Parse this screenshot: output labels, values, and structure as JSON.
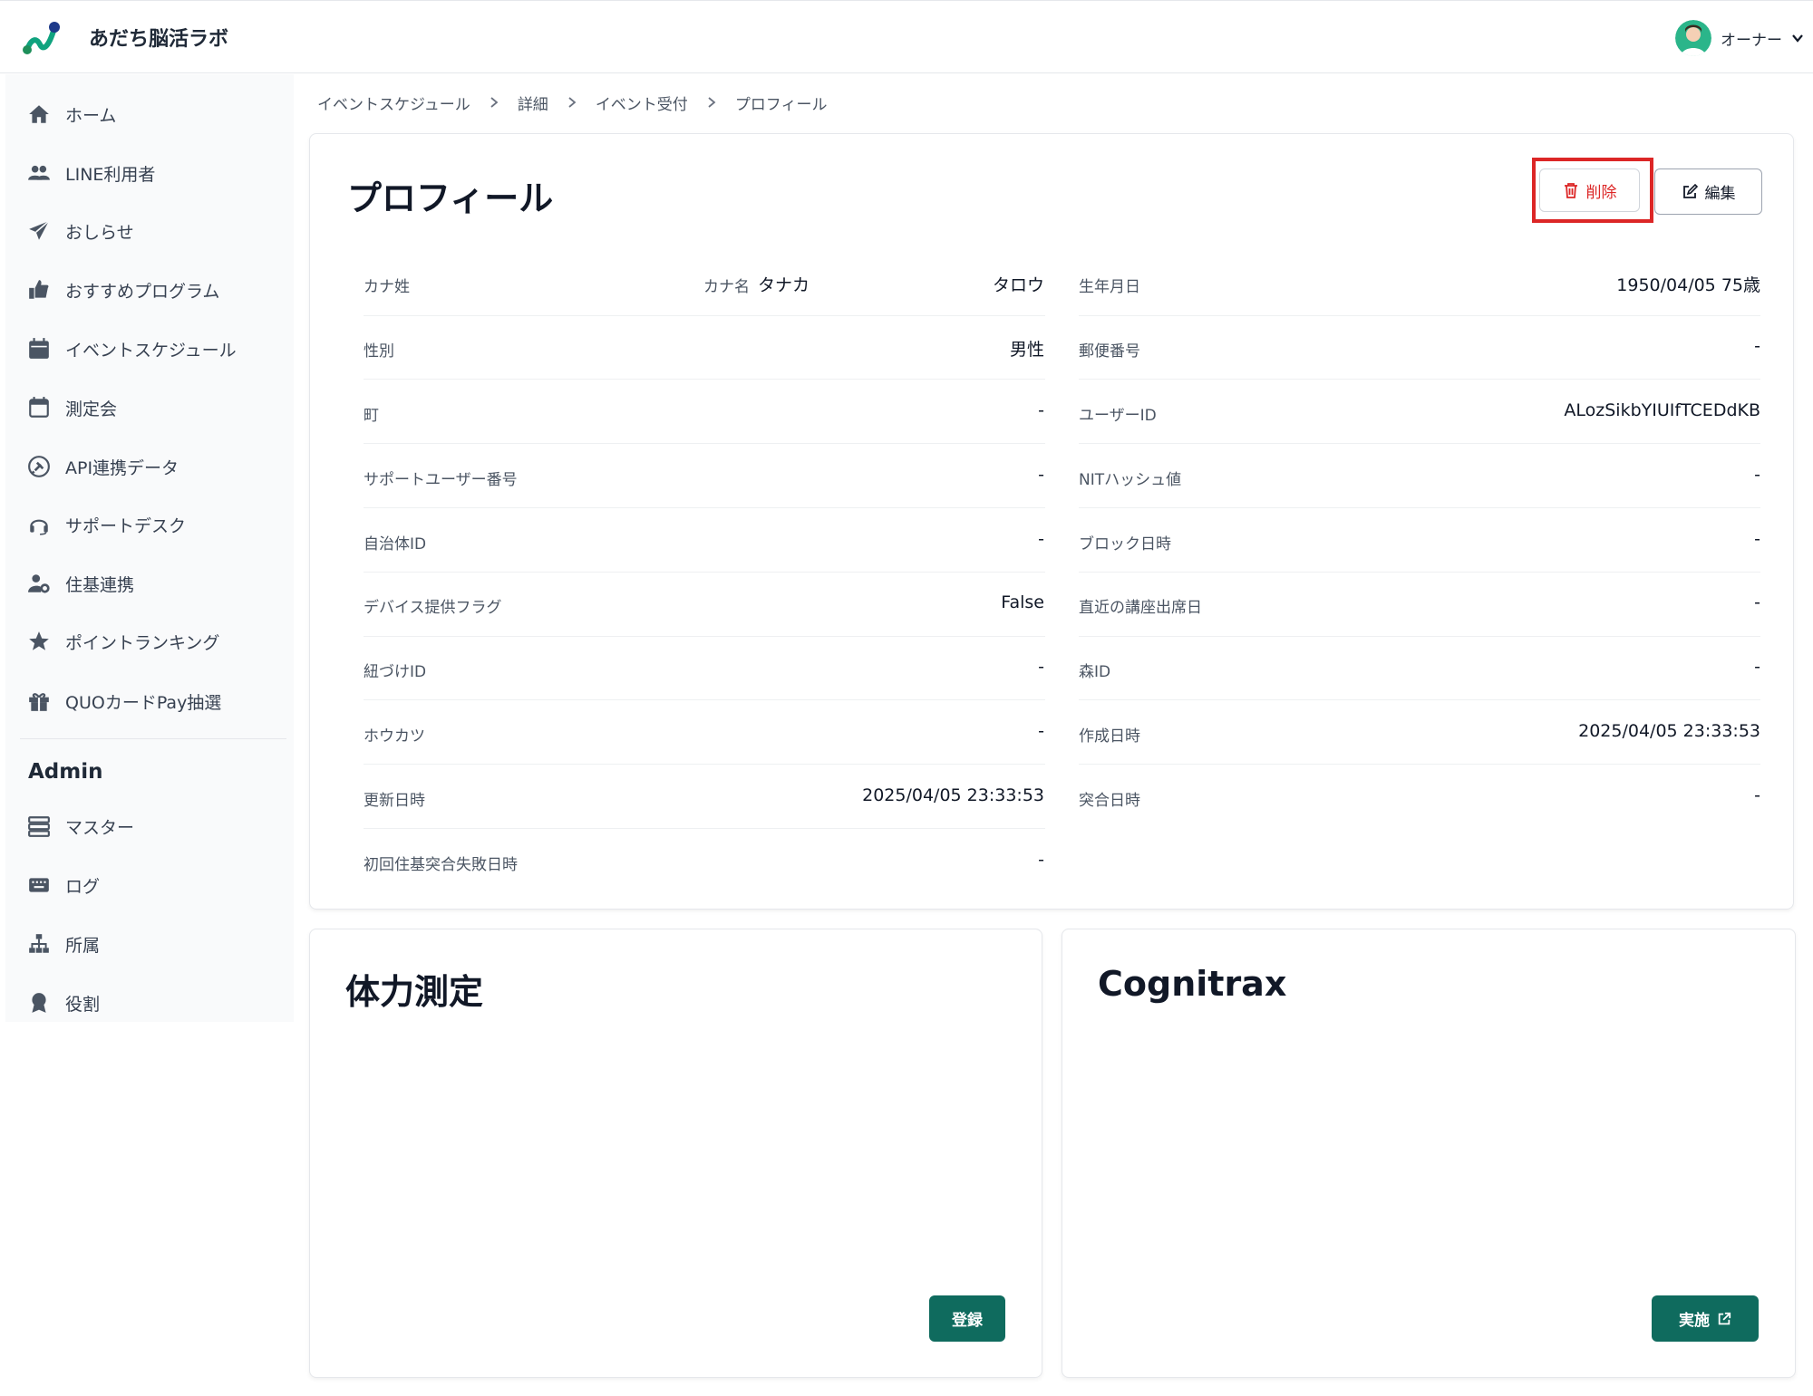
{
  "header": {
    "app_title": "あだち脳活ラボ",
    "user_name": "オーナー",
    "logo_icon": "app-logo",
    "accent_color": "#0f6b5e"
  },
  "sidebar": {
    "items": [
      {
        "label": "ホーム",
        "icon": "home-icon"
      },
      {
        "label": "LINE利用者",
        "icon": "users-icon"
      },
      {
        "label": "おしらせ",
        "icon": "send-icon"
      },
      {
        "label": "おすすめプログラム",
        "icon": "thumbs-up-icon"
      },
      {
        "label": "イベントスケジュール",
        "icon": "calendar-filled-icon"
      },
      {
        "label": "測定会",
        "icon": "calendar-outline-icon"
      },
      {
        "label": "API連携データ",
        "icon": "plug-icon"
      },
      {
        "label": "サポートデスク",
        "icon": "headset-icon"
      },
      {
        "label": "住基連携",
        "icon": "user-gear-icon"
      },
      {
        "label": "ポイントランキング",
        "icon": "star-icon"
      },
      {
        "label": "QUOカードPay抽選",
        "icon": "gift-icon"
      }
    ],
    "admin_title": "Admin",
    "admin_items": [
      {
        "label": "マスター",
        "icon": "server-icon"
      },
      {
        "label": "ログ",
        "icon": "keyboard-icon"
      },
      {
        "label": "所属",
        "icon": "sitemap-icon"
      },
      {
        "label": "役割",
        "icon": "award-icon"
      }
    ]
  },
  "breadcrumb": [
    "イベントスケジュール",
    "詳細",
    "イベント受付",
    "プロフィール"
  ],
  "profile": {
    "title": "プロフィール",
    "delete_label": "削除",
    "edit_label": "編集",
    "left_fields": [
      {
        "label": "カナ姓",
        "value": "タナカ",
        "label2": "カナ名",
        "value2": "タロウ"
      },
      {
        "label": "性別",
        "value": "男性"
      },
      {
        "label": "町",
        "value": "-"
      },
      {
        "label": "サポートユーザー番号",
        "value": "-"
      },
      {
        "label": "自治体ID",
        "value": "-"
      },
      {
        "label": "デバイス提供フラグ",
        "value": "False"
      },
      {
        "label": "紐づけID",
        "value": "-"
      },
      {
        "label": "ホウカツ",
        "value": "-"
      },
      {
        "label": "更新日時",
        "value": "2025/04/05 23:33:53"
      },
      {
        "label": "初回住基突合失敗日時",
        "value": "-"
      }
    ],
    "right_fields": [
      {
        "label": "生年月日",
        "value": "1950/04/05 75歳"
      },
      {
        "label": "郵便番号",
        "value": "-"
      },
      {
        "label": "ユーザーID",
        "value": "ALozSikbYIUIfTCEDdKB"
      },
      {
        "label": "NITハッシュ値",
        "value": "-"
      },
      {
        "label": "ブロック日時",
        "value": "-"
      },
      {
        "label": "直近の講座出席日",
        "value": "-"
      },
      {
        "label": "森ID",
        "value": "-"
      },
      {
        "label": "作成日時",
        "value": "2025/04/05 23:33:53"
      },
      {
        "label": "突合日時",
        "value": "-"
      }
    ]
  },
  "fitness_card": {
    "title": "体力測定",
    "button_label": "登録"
  },
  "cognitrax_card": {
    "title": "Cognitrax",
    "button_label": "実施"
  }
}
